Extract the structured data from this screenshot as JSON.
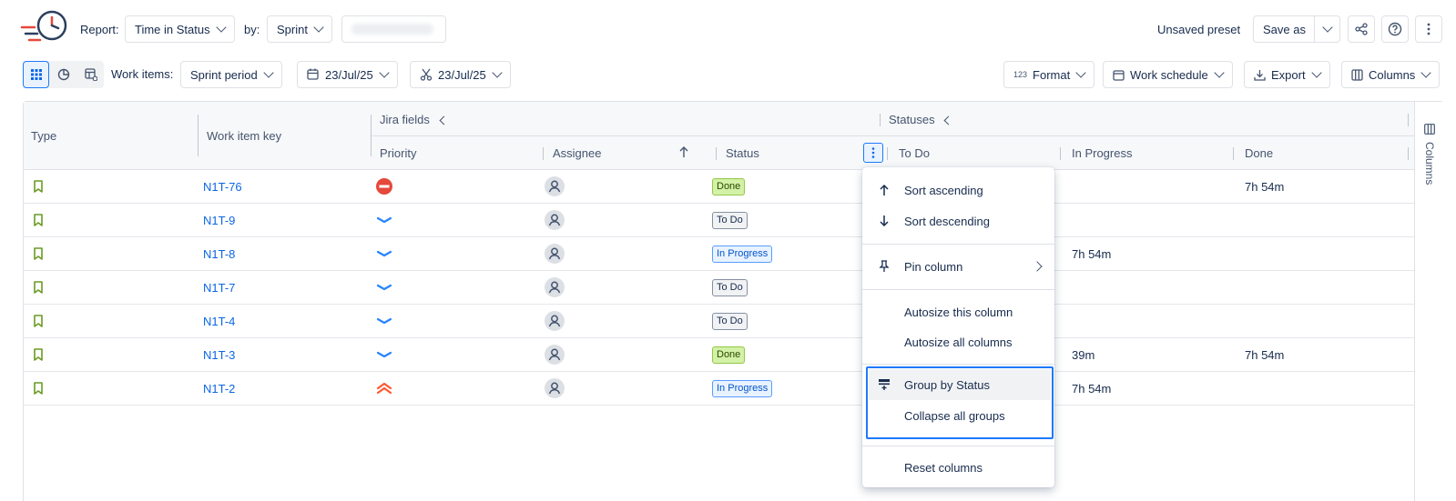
{
  "toolbar": {
    "report_label": "Report:",
    "report_value": "Time in Status",
    "by_label": "by:",
    "by_value": "Sprint",
    "unsaved_preset": "Unsaved preset",
    "save_as": "Save as"
  },
  "filters": {
    "work_items_label": "Work items:",
    "period": "Sprint period",
    "start_date": "23/Jul/25",
    "end_date": "23/Jul/25",
    "format": "Format",
    "format_prefix": "123",
    "work_schedule": "Work schedule",
    "export": "Export",
    "columns": "Columns"
  },
  "grid": {
    "group_jira_fields": "Jira fields",
    "group_statuses": "Statuses",
    "headers": {
      "type": "Type",
      "key": "Work item key",
      "priority": "Priority",
      "assignee": "Assignee",
      "status": "Status",
      "todo": "To Do",
      "in_progress": "In Progress",
      "done": "Done"
    },
    "side_panel_label": "Columns",
    "rows": [
      {
        "key": "N1T-76",
        "priority": "highest-blocker",
        "status": "Done",
        "in_progress": "",
        "done": "7h 54m"
      },
      {
        "key": "N1T-9",
        "priority": "low",
        "status": "To Do",
        "in_progress": "",
        "done": ""
      },
      {
        "key": "N1T-8",
        "priority": "low",
        "status": "In Progress",
        "in_progress": "7h 54m",
        "done": ""
      },
      {
        "key": "N1T-7",
        "priority": "low",
        "status": "To Do",
        "in_progress": "",
        "done": ""
      },
      {
        "key": "N1T-4",
        "priority": "low",
        "status": "To Do",
        "in_progress": "",
        "done": ""
      },
      {
        "key": "N1T-3",
        "priority": "low",
        "status": "Done",
        "in_progress": "39m",
        "done": "7h 54m"
      },
      {
        "key": "N1T-2",
        "priority": "highest",
        "status": "In Progress",
        "in_progress": "7h 54m",
        "done": ""
      }
    ]
  },
  "menu": {
    "sort_asc": "Sort ascending",
    "sort_desc": "Sort descending",
    "pin_column": "Pin column",
    "autosize_this": "Autosize this column",
    "autosize_all": "Autosize all columns",
    "group_by_status": "Group by Status",
    "collapse_all": "Collapse all groups",
    "reset_columns": "Reset columns"
  },
  "colors": {
    "link": "#0c66e4",
    "type_icon": "#6a9a23",
    "done_bg": "#d3f1a7",
    "done_border": "#94c748",
    "inprogress_bg": "#e9f2ff",
    "inprogress_border": "#579dff",
    "todo_bg": "#f1f2f4",
    "todo_border": "#8590a2",
    "focus_ring": "#1d7afc",
    "priority_low": "#2684ff",
    "priority_high": "#ff5630",
    "blocker": "#e5493a"
  }
}
